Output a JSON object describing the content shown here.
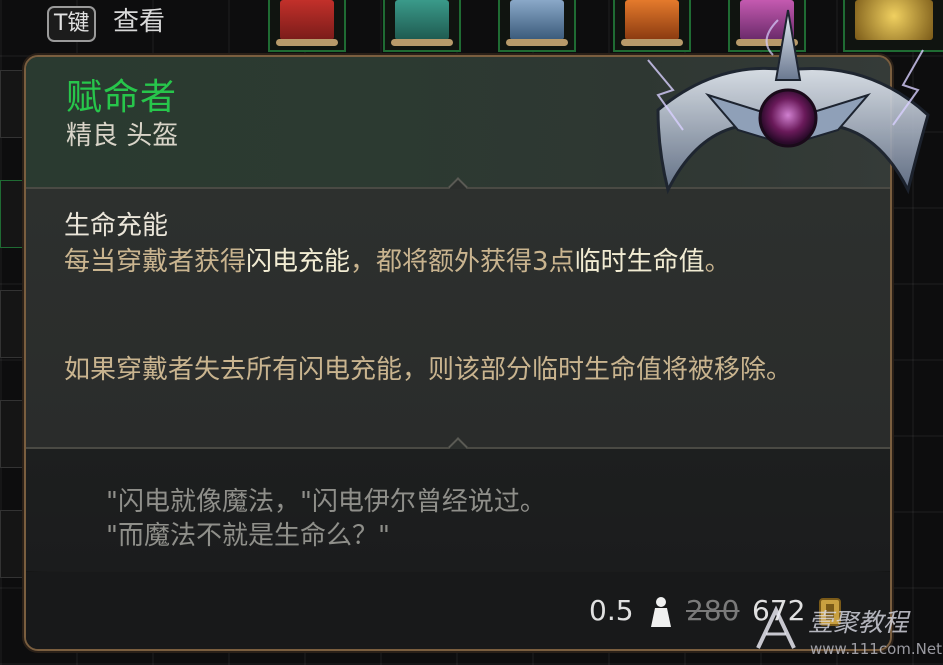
{
  "topbar": {
    "key_label": "T键",
    "view_label": "查看",
    "scrolls": [
      {
        "icon": "red-scroll-icon",
        "color": "#c2302a"
      },
      {
        "icon": "teal-scroll-icon",
        "color": "#3a9a8a"
      },
      {
        "icon": "blue-scroll-icon",
        "color": "#6a8ab0"
      },
      {
        "icon": "orange-scroll-icon",
        "color": "#d4681c"
      },
      {
        "icon": "purple-scroll-icon",
        "color": "#b64a9c"
      }
    ]
  },
  "tooltip": {
    "name": "赋命者",
    "name_color": "#27c64b",
    "type": "精良 头盔",
    "passive_title": "生命充能",
    "desc1_before": "每当穿戴者获得",
    "desc1_highlight": "闪电充能",
    "desc1_mid": "，都将额外获得3点",
    "desc1_highlight2": "临时生命值",
    "desc1_after": "。",
    "desc2": "如果穿戴者失去所有闪电充能，则该部分临时生命值将被移除。",
    "quote_line1": "\"闪电就像魔法，\"闪电伊尔曾经说过。",
    "quote_line2": "\"而魔法不就是生命么？\"",
    "weight": "0.5",
    "weight_icon": "weight-icon",
    "price_old": "280",
    "price_new": "672",
    "coin_icon": "gold-coin-icon",
    "item_art": "electric-helmet-icon"
  },
  "watermark": {
    "brand": "壹聚教程",
    "url": "www.111com.Net"
  }
}
